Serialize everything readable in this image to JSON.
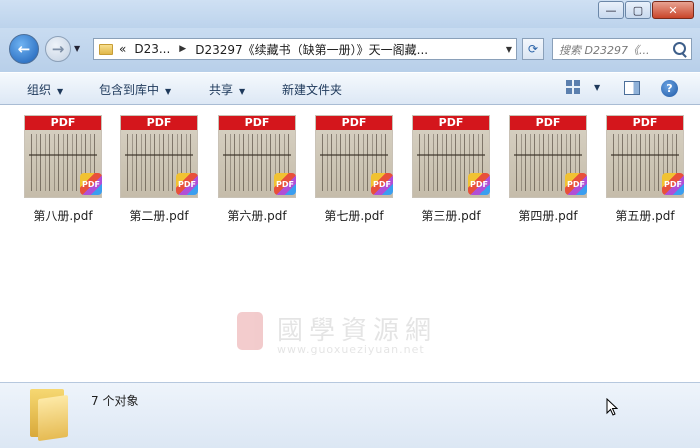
{
  "window": {
    "buttons": {
      "minimize": "—",
      "maximize": "▢",
      "close": "✕"
    }
  },
  "address": {
    "crumbs": [
      "D23...",
      "D23297《续藏书（缺第一册）》天一阁藏..."
    ],
    "prefix": "«",
    "search_placeholder": "搜索 D23297《..."
  },
  "toolbar": {
    "organize": "组织",
    "include_library": "包含到库中",
    "share": "共享",
    "new_folder": "新建文件夹"
  },
  "files": [
    {
      "name": "第八册.pdf"
    },
    {
      "name": "第二册.pdf"
    },
    {
      "name": "第六册.pdf"
    },
    {
      "name": "第七册.pdf"
    },
    {
      "name": "第三册.pdf"
    },
    {
      "name": "第四册.pdf"
    },
    {
      "name": "第五册.pdf"
    }
  ],
  "thumb_label": "PDF",
  "badge_label": "PDF",
  "watermark": {
    "title": "國學資源網",
    "url": "www.guoxueziyuan.net"
  },
  "status": {
    "count_text": "7 个对象"
  }
}
